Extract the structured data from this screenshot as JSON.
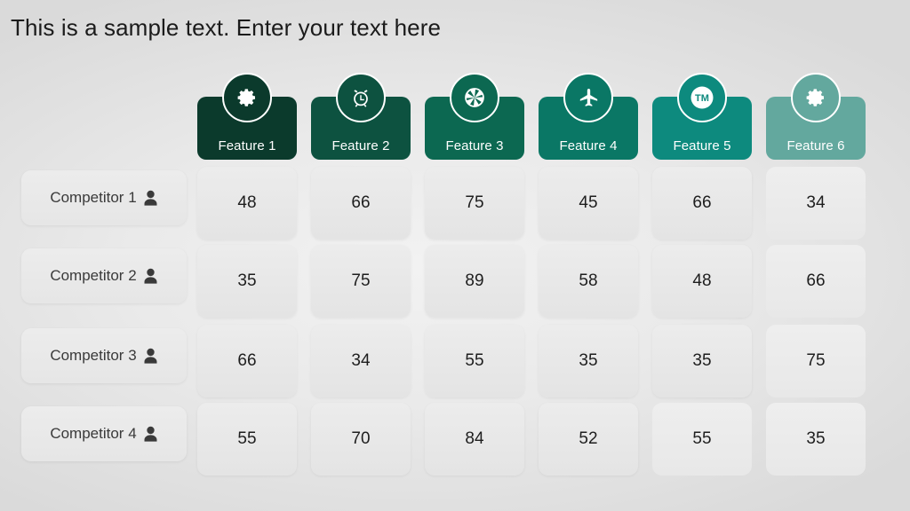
{
  "slide": {
    "title": "This is a sample text. Enter your text here",
    "background_color": "#e6e6e6"
  },
  "columns": [
    {
      "label": "Feature 1",
      "icon": "gear-icon",
      "color": "#0b3a2c"
    },
    {
      "label": "Feature 2",
      "icon": "alarm-icon",
      "color": "#0d5240"
    },
    {
      "label": "Feature 3",
      "icon": "aperture-icon",
      "color": "#0c6851"
    },
    {
      "label": "Feature 4",
      "icon": "airplane-icon",
      "color": "#0a7765"
    },
    {
      "label": "Feature 5",
      "icon": "trademark-icon",
      "color": "#0d8a7e"
    },
    {
      "label": "Feature 6",
      "icon": "gear-icon",
      "color": "#63a89e"
    }
  ],
  "rows": [
    {
      "label": "Competitor 1",
      "icon": "person-icon",
      "values": [
        "48",
        "66",
        "75",
        "45",
        "66",
        "34"
      ]
    },
    {
      "label": "Competitor 2",
      "icon": "person-icon",
      "values": [
        "35",
        "75",
        "89",
        "58",
        "48",
        "66"
      ]
    },
    {
      "label": "Competitor 3",
      "icon": "person-icon",
      "values": [
        "66",
        "34",
        "55",
        "35",
        "35",
        "75"
      ]
    },
    {
      "label": "Competitor 4",
      "icon": "person-icon",
      "values": [
        "55",
        "70",
        "84",
        "52",
        "55",
        "35"
      ]
    }
  ],
  "chart_data": {
    "type": "table",
    "title": "This is a sample text. Enter your text here",
    "categories": [
      "Feature 1",
      "Feature 2",
      "Feature 3",
      "Feature 4",
      "Feature 5",
      "Feature 6"
    ],
    "series": [
      {
        "name": "Competitor 1",
        "values": [
          48,
          66,
          75,
          45,
          66,
          34
        ]
      },
      {
        "name": "Competitor 2",
        "values": [
          35,
          75,
          89,
          58,
          48,
          66
        ]
      },
      {
        "name": "Competitor 3",
        "values": [
          66,
          34,
          55,
          35,
          35,
          75
        ]
      },
      {
        "name": "Competitor 4",
        "values": [
          55,
          70,
          84,
          52,
          55,
          35
        ]
      }
    ],
    "xlabel": "",
    "ylabel": "",
    "grid": false,
    "legend": "none"
  }
}
